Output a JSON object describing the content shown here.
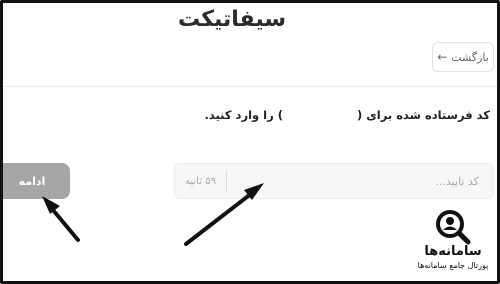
{
  "header": {
    "logo_text": "سیفاتیکت",
    "back_label": "بازگشت",
    "back_icon": "arrow-right-icon"
  },
  "verification": {
    "instruction_prefix": "کد فرستاده شده برای (",
    "instruction_suffix": ") را وارد کنید.",
    "code_placeholder": "کد تایید...",
    "code_value": "",
    "timer_text": "۵۹ ثانیه",
    "continue_label": "ادامه"
  },
  "watermark": {
    "name": "سامانه‌ها",
    "tagline": "پورتال جامع سامانه‌ها"
  },
  "colors": {
    "continue_button": "#a6a6a6",
    "input_background": "#f7f7f7",
    "logo_mark": "#c4202b",
    "annotation_arrow": "#111111"
  }
}
